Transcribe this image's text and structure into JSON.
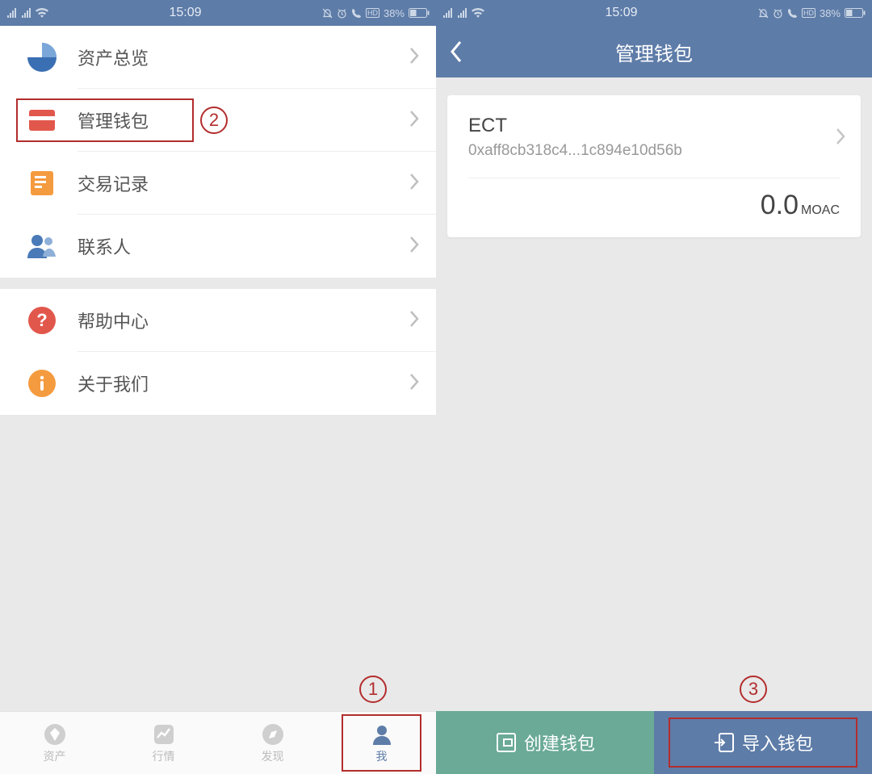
{
  "status": {
    "time": "15:09",
    "battery_pct": "38%",
    "hd": "HD"
  },
  "left": {
    "menu": {
      "assets_overview": "资产总览",
      "manage_wallet": "管理钱包",
      "tx_history": "交易记录",
      "contacts": "联系人",
      "help": "帮助中心",
      "about": "关于我们"
    },
    "tabs": {
      "assets": "资产",
      "market": "行情",
      "discover": "发现",
      "me": "我"
    }
  },
  "right": {
    "title": "管理钱包",
    "wallet": {
      "name": "ECT",
      "address": "0xaff8cb318c4...1c894e10d56b",
      "balance_value": "0.0",
      "balance_unit": "MOAC"
    },
    "actions": {
      "create": "创建钱包",
      "import": "导入钱包"
    }
  },
  "annotations": {
    "a1": "1",
    "a2": "2",
    "a3": "3"
  }
}
